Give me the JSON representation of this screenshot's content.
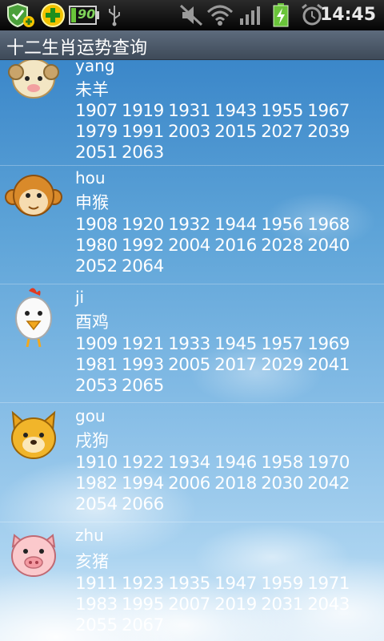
{
  "status_bar": {
    "battery_text": "90",
    "time": "14:45",
    "icons": [
      "security-shield-icon",
      "add-plus-icon",
      "battery-icon",
      "usb-icon",
      "mute-icon",
      "wifi-icon",
      "signal-icon",
      "charging-battery-icon",
      "alarm-clock-icon"
    ]
  },
  "app": {
    "title": "十二生肖运势查询"
  },
  "zodiac_list": [
    {
      "animal": "goat",
      "pinyin": "yang",
      "name": "未羊",
      "years": "1907 1919 1931 1943 1955 1967\n1979 1991 2003 2015 2027 2039\n2051 2063"
    },
    {
      "animal": "monkey",
      "pinyin": "hou",
      "name": "申猴",
      "years": "1908 1920 1932 1944 1956 1968\n1980 1992 2004 2016 2028 2040\n2052 2064"
    },
    {
      "animal": "rooster",
      "pinyin": "ji",
      "name": "酉鸡",
      "years": "1909 1921 1933 1945 1957 1969\n1981 1993 2005 2017 2029 2041\n2053 2065"
    },
    {
      "animal": "dog",
      "pinyin": "gou",
      "name": "戌狗",
      "years": "1910 1922 1934 1946 1958 1970\n1982 1994 2006 2018 2030 2042\n2054 2066"
    },
    {
      "animal": "pig",
      "pinyin": "zhu",
      "name": "亥猪",
      "years": "1911 1923 1935 1947 1959 1971\n1983 1995 2007 2019 2031 2043\n2055 2067"
    }
  ]
}
